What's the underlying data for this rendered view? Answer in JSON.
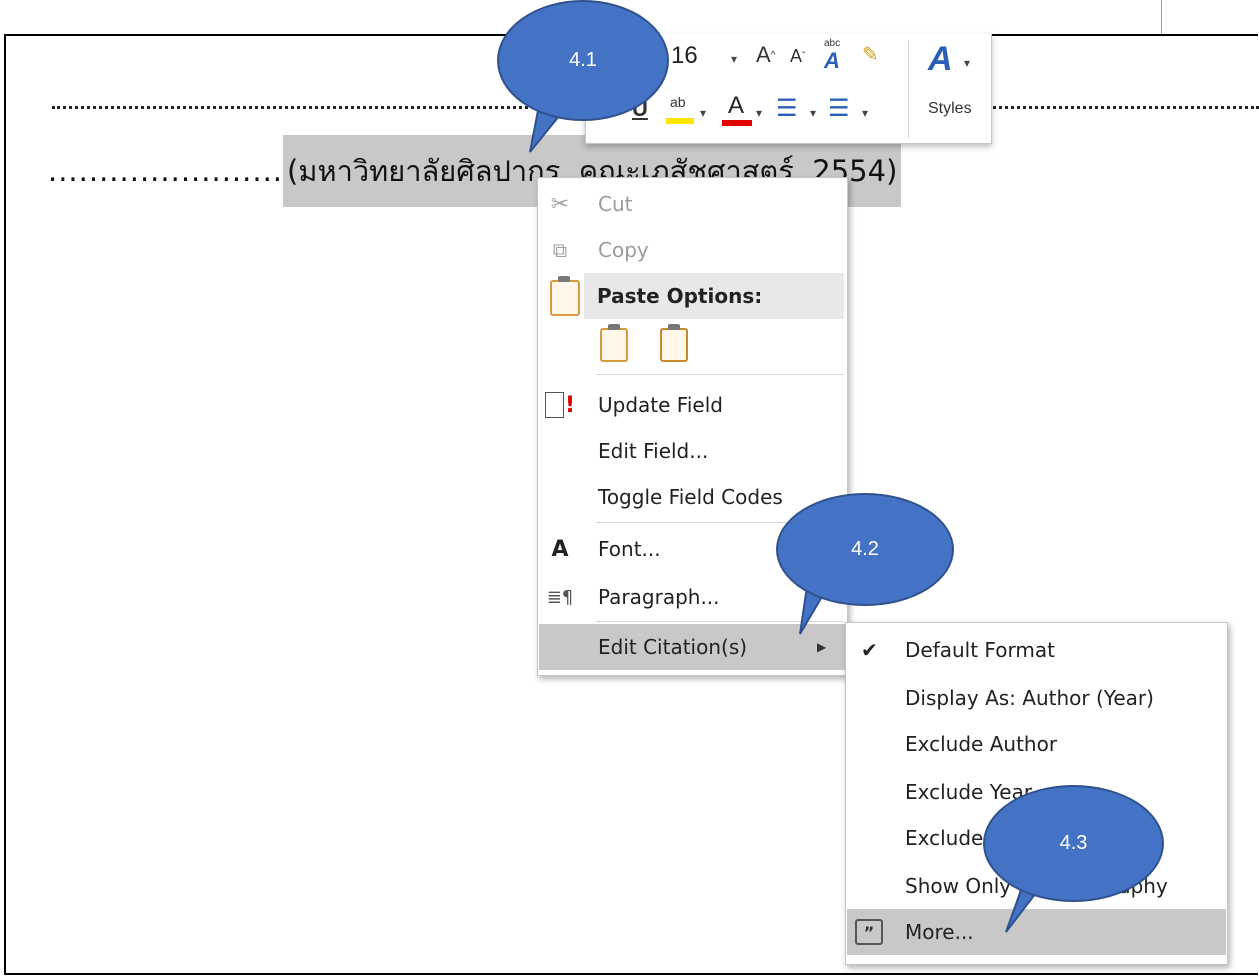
{
  "document": {
    "leader_text": ".......................",
    "citation_text": "(มหาวิทยาลัยศิลปากร, คณะเภสัชศาสตร์, 2554)"
  },
  "mini_toolbar": {
    "font_size": "16",
    "styles_label": "Styles"
  },
  "context_menu": {
    "items": [
      {
        "label": "Cut",
        "icon": "scissors-icon",
        "enabled": false
      },
      {
        "label": "Copy",
        "icon": "copy-icon",
        "enabled": false
      },
      {
        "label": "Paste Options:",
        "icon": "paste-icon",
        "header": true
      },
      {
        "label": "Update Field",
        "icon": "update-field-icon"
      },
      {
        "label": "Edit Field...",
        "icon": ""
      },
      {
        "label": "Toggle Field Codes",
        "icon": ""
      },
      {
        "label": "Font...",
        "icon": "font-icon"
      },
      {
        "label": "Paragraph...",
        "icon": "paragraph-icon"
      },
      {
        "label": "Edit Citation(s)",
        "icon": "",
        "submenu": true,
        "highlighted": true
      }
    ]
  },
  "submenu": {
    "items": [
      {
        "label": "Default Format",
        "checked": true
      },
      {
        "label": "Display As: Author (Year)"
      },
      {
        "label": "Exclude Author"
      },
      {
        "label": "Exclude Year"
      },
      {
        "label": "Exclude Title"
      },
      {
        "label": "Show Only in Bibliography"
      },
      {
        "label": "More...",
        "icon": "citation-more-icon",
        "highlighted": true
      }
    ]
  },
  "callouts": [
    {
      "label": "4.1"
    },
    {
      "label": "4.2"
    },
    {
      "label": "4.3"
    }
  ],
  "colors": {
    "callout_fill": "#4472c4",
    "highlight": "#c8c8c8",
    "paste_header_bg": "#e8e8e8"
  }
}
